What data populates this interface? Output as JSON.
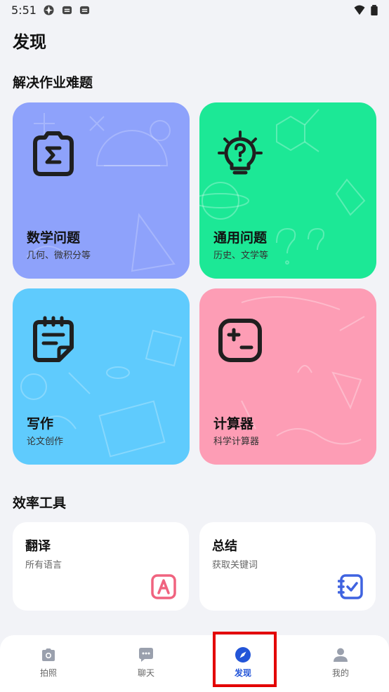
{
  "status_bar": {
    "time": "5:51"
  },
  "page_title": "发现",
  "section_homework": {
    "title": "解决作业难题",
    "cards": [
      {
        "title": "数学问题",
        "subtitle": "几何、微积分等",
        "color": "#8ea2fb",
        "icon": "sigma-camera-icon"
      },
      {
        "title": "通用问题",
        "subtitle": "历史、文学等",
        "color": "#1ce896",
        "icon": "question-bulb-icon"
      },
      {
        "title": "写作",
        "subtitle": "论文创作",
        "color": "#5fcbfd",
        "icon": "notepad-icon"
      },
      {
        "title": "计算器",
        "subtitle": "科学计算器",
        "color": "#fd9db5",
        "icon": "calculator-icon"
      }
    ]
  },
  "section_tools": {
    "title": "效率工具",
    "tools": [
      {
        "title": "翻译",
        "subtitle": "所有语言",
        "icon": "translate-icon",
        "accent": "#f0637f"
      },
      {
        "title": "总结",
        "subtitle": "获取关键词",
        "icon": "summary-check-icon",
        "accent": "#3f63e0"
      }
    ]
  },
  "tab_bar": {
    "tabs": [
      {
        "label": "拍照",
        "icon": "camera-icon",
        "active": false
      },
      {
        "label": "聊天",
        "icon": "chat-icon",
        "active": false
      },
      {
        "label": "发现",
        "icon": "compass-icon",
        "active": true
      },
      {
        "label": "我的",
        "icon": "person-icon",
        "active": false
      }
    ]
  },
  "colors": {
    "accent": "#2355d8",
    "highlight": "#e30000"
  }
}
